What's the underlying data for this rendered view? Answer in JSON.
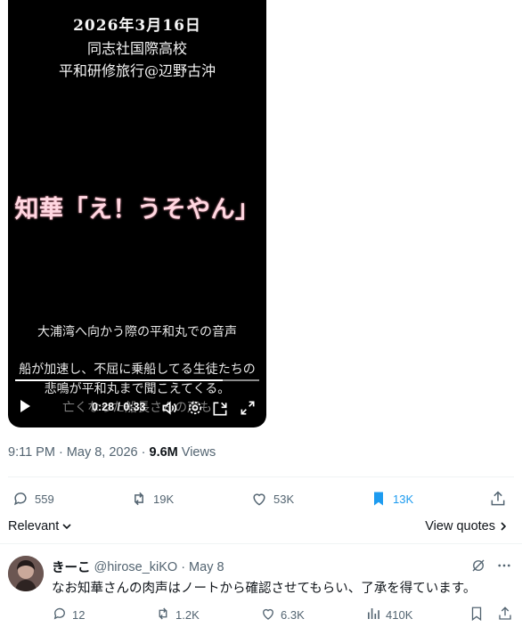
{
  "video": {
    "overlay_date": "2026年3月16日",
    "overlay_school": "同志社国際高校",
    "overlay_trip": "平和研修旅行@辺野古沖",
    "overlay_headline": "知華「え！うそやん」",
    "subtitle_1": "大浦湾へ向かう際の平和丸での音声",
    "subtitle_2": "船が加速し、不屈に乗船してる生徒たちの",
    "subtitle_3": "悲鳴が平和丸まで聞こえてくる。",
    "subtitle_4": "亡くなった船長さんの声も",
    "time_display": "0:28 / 0:33",
    "progress": 0.85
  },
  "meta": {
    "timestamp": "9:11 PM · May 8, 2026 · ",
    "views_count": "9.6M",
    "views_label": " Views"
  },
  "actions": {
    "replies": "559",
    "reposts": "19K",
    "likes": "53K",
    "bookmarks": "13K"
  },
  "sort": {
    "label": "Relevant",
    "view_quotes": "View quotes"
  },
  "reply": {
    "name": "きーこ",
    "handle": "@hirose_kiKO",
    "dot": "·",
    "date": "May 8",
    "text": "なお知華さんの肉声はノートから確認させてもらい、了承を得ています。",
    "replies": "12",
    "reposts": "1.2K",
    "likes": "6.3K",
    "views": "410K"
  },
  "colors": {
    "accent": "#1d9bf0",
    "headline": "#ffd7e1",
    "muted": "#536471",
    "text": "#0f1419"
  },
  "icons": [
    "play-icon",
    "volume-icon",
    "settings-gear-icon",
    "minimize-icon",
    "fullscreen-icon",
    "reply-icon",
    "repost-icon",
    "like-icon",
    "bookmark-icon",
    "share-icon",
    "chevron-down-icon",
    "chevron-right-icon",
    "grok-icon",
    "more-icon",
    "views-icon"
  ]
}
